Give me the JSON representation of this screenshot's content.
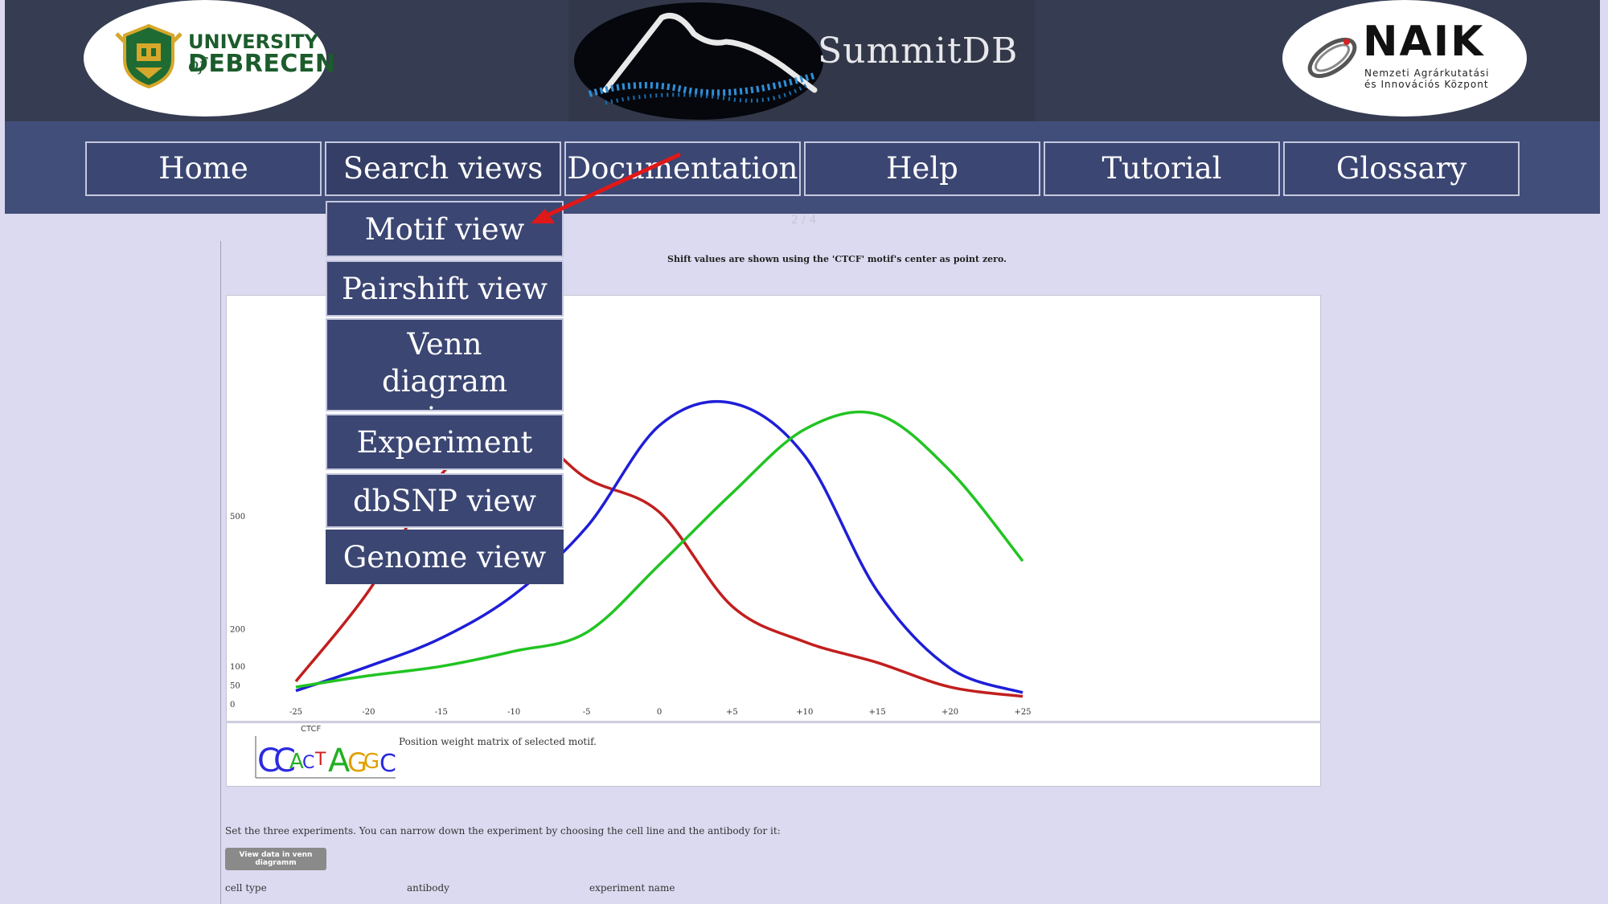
{
  "header": {
    "left_logo": {
      "line1": "UNIVERSITY",
      "line1_of": "of",
      "line2": "DEBRECEN"
    },
    "site_title": "SummitDB",
    "right_logo": {
      "title": "NAIK",
      "sub1": "Nemzeti Agrárkutatási",
      "sub2": "és Innovációs Központ"
    }
  },
  "nav": {
    "items": [
      {
        "label": "Home"
      },
      {
        "label": "Search views"
      },
      {
        "label": "Documentation"
      },
      {
        "label": "Help"
      },
      {
        "label": "Tutorial"
      },
      {
        "label": "Glossary"
      }
    ]
  },
  "dropdown": {
    "items": [
      {
        "label": "Motif view"
      },
      {
        "label": "Pairshift view"
      },
      {
        "label": "Venn diagram view"
      },
      {
        "label": "Experiment view"
      },
      {
        "label": "dbSNP view"
      },
      {
        "label": "Genome view"
      }
    ]
  },
  "content": {
    "page_counter": "2 / 4",
    "chart_note": "Shift values are shown using the 'CTCF' motif's center as point zero.",
    "motif_name": "CTCF",
    "pwm_caption": "Position weight matrix of selected motif.",
    "set_text": "Set the three experiments. You can narrow down the experiment by choosing the cell line and the antibody for it:",
    "venn_button": "View data in venn diagramm",
    "fields": {
      "cell_type": "cell type",
      "antibody": "antibody",
      "experiment_name": "experiment name"
    }
  },
  "colors": {
    "header_bg": "#363c52",
    "nav_bg": "#414e7a",
    "nav_item_bg": "#3b4673",
    "page_bg": "#dcdaf0",
    "annotation_arrow": "#e01818"
  },
  "chart_data": {
    "type": "line",
    "title": "",
    "xlabel": "",
    "ylabel": "",
    "x": [
      -25,
      -20,
      -15,
      -10,
      -5,
      0,
      5,
      10,
      15,
      20,
      25
    ],
    "x_tick_labels": [
      "-25",
      "-20",
      "-15",
      "-10",
      "-5",
      "0",
      "+5",
      "+10",
      "+15",
      "+20",
      "+25"
    ],
    "y_ticks": [
      0,
      50,
      100,
      200,
      500
    ],
    "y_tick_labels": [
      "0",
      "50",
      "100",
      "200",
      "500"
    ],
    "ylim": [
      0,
      1000
    ],
    "series": [
      {
        "color": "#c21e1e",
        "values": [
          60,
          300,
          610,
          740,
          600,
          510,
          260,
          165,
          110,
          45,
          20
        ]
      },
      {
        "color": "#1e1ed8",
        "values": [
          35,
          100,
          175,
          290,
          470,
          740,
          800,
          660,
          300,
          95,
          30
        ]
      },
      {
        "color": "#22c422",
        "values": [
          45,
          75,
          100,
          140,
          190,
          370,
          560,
          730,
          770,
          620,
          380
        ]
      }
    ]
  }
}
